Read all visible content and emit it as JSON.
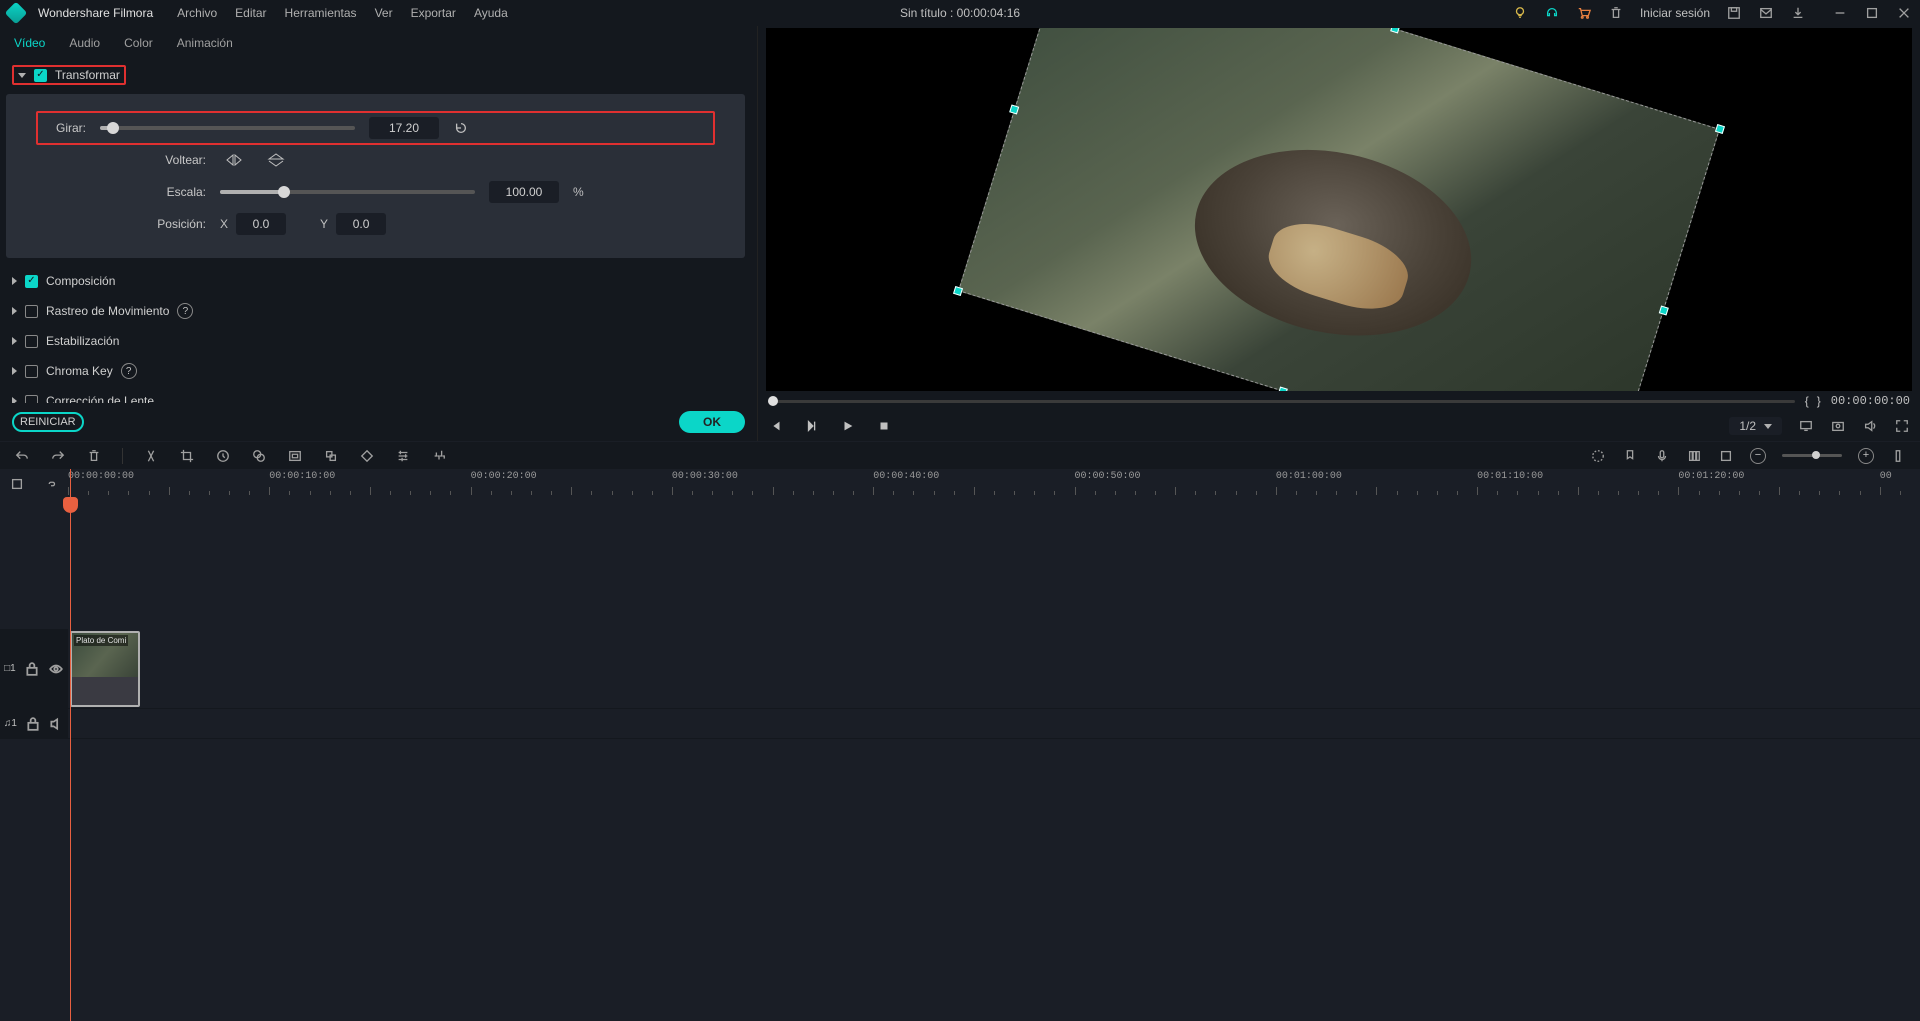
{
  "titlebar": {
    "brand": "Wondershare Filmora",
    "menus": [
      "Archivo",
      "Editar",
      "Herramientas",
      "Ver",
      "Exportar",
      "Ayuda"
    ],
    "project": "Sin título : 00:00:04:16",
    "signin": "Iniciar sesión"
  },
  "tabs": {
    "video": "Vídeo",
    "audio": "Audio",
    "color": "Color",
    "anim": "Animación"
  },
  "sections": {
    "transformar": "Transformar",
    "composicion": "Composición",
    "rastreo": "Rastreo de Movimiento",
    "estabilizacion": "Estabilización",
    "chroma": "Chroma Key",
    "lente": "Corrección de Lente"
  },
  "transform": {
    "girar_label": "Girar:",
    "girar_value": "17.20",
    "voltear_label": "Voltear:",
    "escala_label": "Escala:",
    "escala_value": "100.00",
    "escala_unit": "%",
    "posicion_label": "Posición:",
    "x_label": "X",
    "x_value": "0.0",
    "y_label": "Y",
    "y_value": "0.0"
  },
  "buttons": {
    "reiniciar": "REINICIAR",
    "ok": "OK"
  },
  "preview": {
    "timecode": "00:00:00:00",
    "zoom": "1/2",
    "bracket_l": "{",
    "bracket_r": "}"
  },
  "ruler": [
    "00:00:00:00",
    "00:00:10:00",
    "00:00:20:00",
    "00:00:30:00",
    "00:00:40:00",
    "00:00:50:00",
    "00:01:00:00",
    "00:01:10:00",
    "00:01:20:00",
    "00"
  ],
  "clip": {
    "name": "Plato de Comi"
  },
  "track": {
    "video": "□1",
    "audio": "♫1"
  }
}
